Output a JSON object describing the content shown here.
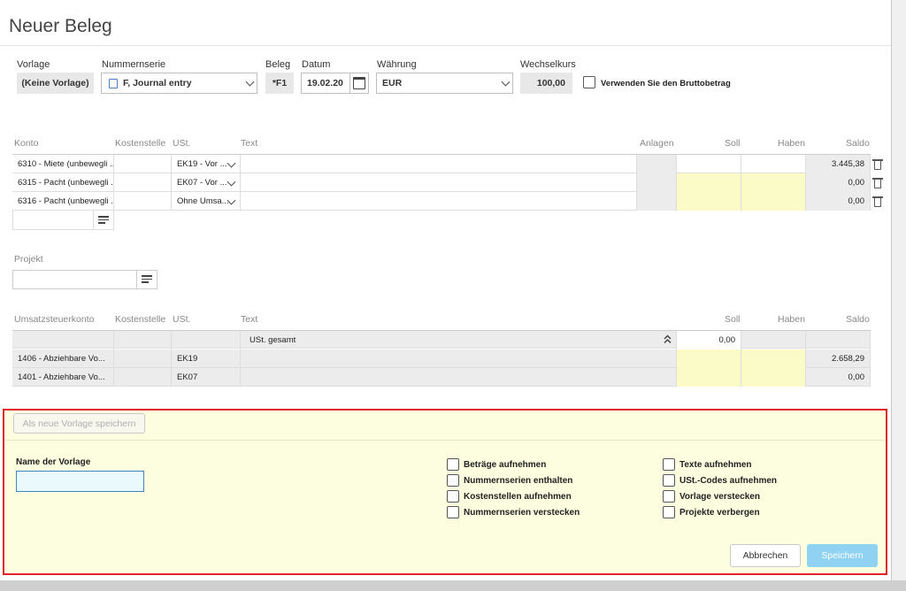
{
  "title": "Neuer Beleg",
  "header": {
    "vorlage_label": "Vorlage",
    "vorlage_value": "(Keine Vorlage)",
    "nummernserie_label": "Nummernserie",
    "nummernserie_value": "F, Journal entry",
    "beleg_label": "Beleg",
    "beleg_value": "*F1",
    "datum_label": "Datum",
    "datum_value": "19.02.20",
    "waehrung_label": "Währung",
    "waehrung_value": "EUR",
    "wechselkurs_label": "Wechselkurs",
    "wechselkurs_value": "100,00",
    "brutto_label": "Verwenden Sie den Bruttobetrag"
  },
  "entries": {
    "columns": [
      "Konto",
      "Kostenstelle",
      "USt.",
      "Text",
      "Anlagen",
      "Soll",
      "Haben",
      "Saldo"
    ],
    "rows": [
      {
        "konto": "6310 - Miete (unbewegli ...",
        "kostenstelle": "",
        "ust": "EK19 - Vor ...",
        "text": "",
        "soll": "",
        "haben": "",
        "saldo": "3.445,38"
      },
      {
        "konto": "6315 - Pacht (unbewegli ...",
        "kostenstelle": "",
        "ust": "EK07 - Vor ...",
        "text": "",
        "soll": "",
        "haben": "",
        "saldo": "0,00"
      },
      {
        "konto": "6316 - Pacht (unbewegli ...",
        "kostenstelle": "",
        "ust": "Ohne Umsa...",
        "text": "",
        "soll": "",
        "haben": "",
        "saldo": "0,00"
      }
    ]
  },
  "projekt": {
    "label": "Projekt",
    "value": ""
  },
  "tax": {
    "columns": [
      "Umsatzsteuerkonto",
      "Kostenstelle",
      "USt.",
      "Text",
      "Soll",
      "Haben",
      "Saldo"
    ],
    "total_label": "USt. gesamt",
    "total_soll": "0,00",
    "rows": [
      {
        "konto": "1406 - Abziehbare Vo...",
        "ust": "EK19",
        "saldo": "2.658,29"
      },
      {
        "konto": "1401 - Abziehbare Vo...",
        "ust": "EK07",
        "saldo": "0,00"
      }
    ]
  },
  "template_panel": {
    "save_as_template": "Als neue Vorlage speichern",
    "name_label": "Name der Vorlage",
    "name_value": "",
    "options_left": [
      "Beträge aufnehmen",
      "Nummernserien enthalten",
      "Kostenstellen aufnehmen",
      "Nummernserien verstecken"
    ],
    "options_right": [
      "Texte aufnehmen",
      "USt.-Codes aufnehmen",
      "Vorlage verstecken",
      "Projekte verbergen"
    ],
    "cancel": "Abbrechen",
    "save": "Speichern"
  },
  "colors": {
    "highlight_border": "#e0252a",
    "panel_bg": "#fdfde0",
    "yellow_cell": "#fbfbc8",
    "primary_button": "#8fd2f2"
  }
}
